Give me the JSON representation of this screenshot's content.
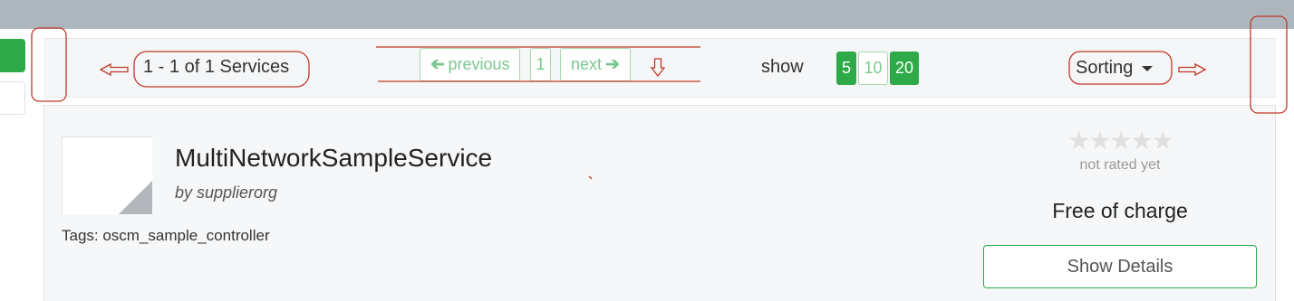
{
  "toolbar": {
    "result_count": "1 - 1 of 1 Services",
    "pager": {
      "previous_label": "previous",
      "previous_icon": "➔",
      "page_label": "1",
      "next_label": "next",
      "next_icon": "➔"
    },
    "show_label": "show",
    "page_sizes": [
      {
        "label": "5",
        "active": true
      },
      {
        "label": "10",
        "active": false
      },
      {
        "label": "20",
        "active": true
      }
    ],
    "sorting_label": "Sorting"
  },
  "service": {
    "title": "MultiNetworkSampleService",
    "supplier": "by supplierorg",
    "tags": "Tags: oscm_sample_controller",
    "stars": "★★★★★",
    "rating_text": "not rated yet",
    "price": "Free of charge",
    "details_label": "Show Details"
  },
  "colors": {
    "accent": "#2eaa48",
    "accent_light": "#7cc78f",
    "annotation": "#c0392b",
    "topbar": "#adb5bd"
  }
}
